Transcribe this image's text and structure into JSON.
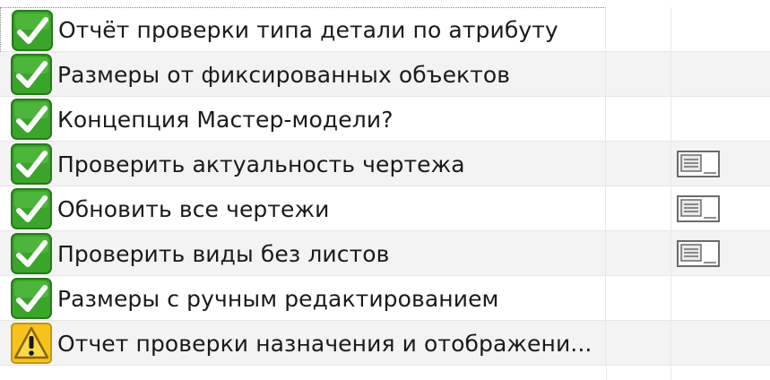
{
  "checks": [
    {
      "label": "Отчёт проверки типа детали по атрибуту",
      "status": "ok",
      "status_icon": "check-icon",
      "action_icon": null
    },
    {
      "label": "Размеры от фиксированных объектов",
      "status": "ok",
      "status_icon": "check-icon",
      "action_icon": null
    },
    {
      "label": "Концепция Мастер-модели?",
      "status": "ok",
      "status_icon": "check-icon",
      "action_icon": null
    },
    {
      "label": "Проверить актуальность чертежа",
      "status": "ok",
      "status_icon": "check-icon",
      "action_icon": "drawing-sheet-icon"
    },
    {
      "label": "Обновить все чертежи",
      "status": "ok",
      "status_icon": "check-icon",
      "action_icon": "drawing-sheet-icon"
    },
    {
      "label": "Проверить виды без листов",
      "status": "ok",
      "status_icon": "check-icon",
      "action_icon": "drawing-sheet-icon"
    },
    {
      "label": "Размеры с ручным редактированием",
      "status": "ok",
      "status_icon": "check-icon",
      "action_icon": null
    },
    {
      "label": "Отчет проверки назначения и отображени...",
      "status": "warning",
      "status_icon": "warning-icon",
      "action_icon": null
    }
  ],
  "colors": {
    "check_green": "#3aa52a",
    "warning_yellow": "#f5c31c",
    "row_alt": "#f3f3f3"
  }
}
